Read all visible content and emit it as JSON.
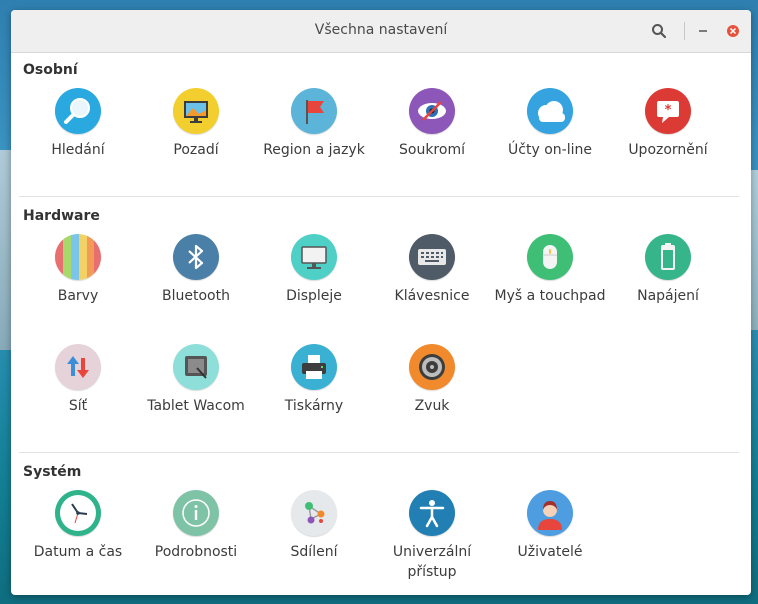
{
  "window": {
    "title": "Všechna nastavení"
  },
  "sections": [
    {
      "title": "Osobní",
      "items": [
        {
          "label": "Hledání",
          "icon": "search-icon"
        },
        {
          "label": "Pozadí",
          "icon": "background-icon"
        },
        {
          "label": "Region a jazyk",
          "icon": "flag-icon"
        },
        {
          "label": "Soukromí",
          "icon": "privacy-eye-icon"
        },
        {
          "label": "Účty on-line",
          "icon": "cloud-icon"
        },
        {
          "label": "Upozornění",
          "icon": "notification-icon"
        }
      ]
    },
    {
      "title": "Hardware",
      "items": [
        {
          "label": "Barvy",
          "icon": "colors-icon"
        },
        {
          "label": "Bluetooth",
          "icon": "bluetooth-icon"
        },
        {
          "label": "Displeje",
          "icon": "display-icon"
        },
        {
          "label": "Klávesnice",
          "icon": "keyboard-icon"
        },
        {
          "label": "Myš a touchpad",
          "icon": "mouse-icon"
        },
        {
          "label": "Napájení",
          "icon": "battery-icon"
        },
        {
          "label": "Síť",
          "icon": "network-icon"
        },
        {
          "label": "Tablet Wacom",
          "icon": "tablet-icon"
        },
        {
          "label": "Tiskárny",
          "icon": "printer-icon"
        },
        {
          "label": "Zvuk",
          "icon": "speaker-icon"
        }
      ]
    },
    {
      "title": "Systém",
      "items": [
        {
          "label": "Datum a čas",
          "icon": "clock-icon"
        },
        {
          "label": "Podrobnosti",
          "icon": "info-icon"
        },
        {
          "label": "Sdílení",
          "icon": "sharing-icon"
        },
        {
          "label": "Univerzální přístup",
          "icon": "accessibility-icon"
        },
        {
          "label": "Uživatelé",
          "icon": "user-icon"
        }
      ]
    }
  ]
}
